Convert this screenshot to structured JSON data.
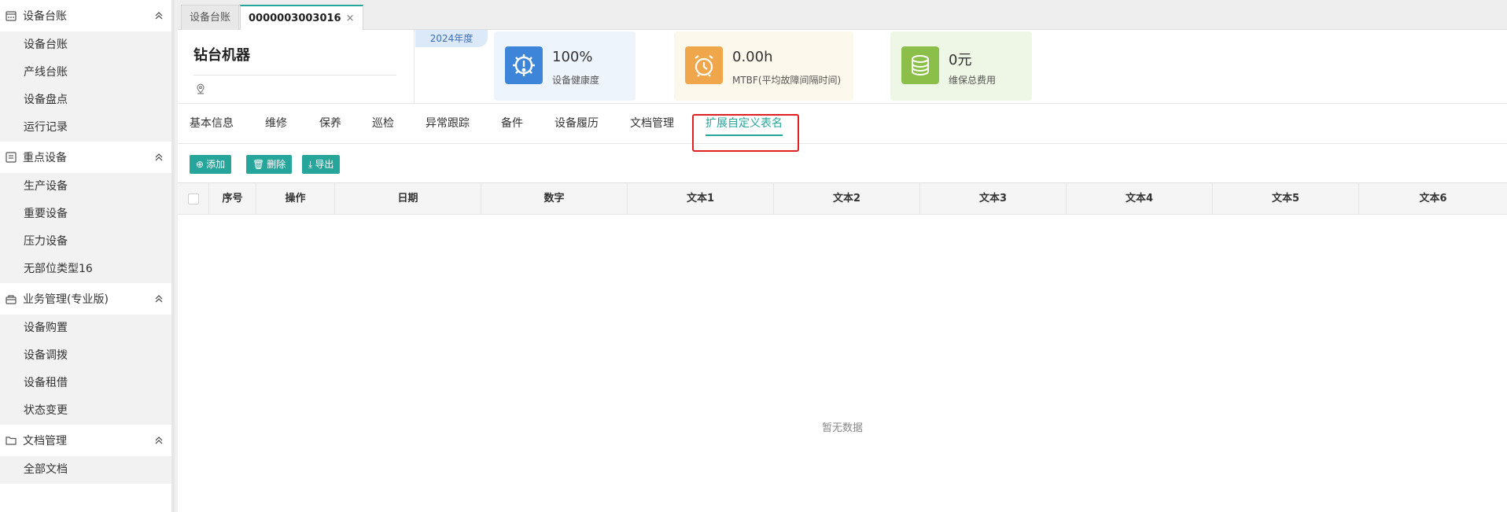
{
  "sidebar": {
    "groups": [
      {
        "label": "设备台账",
        "items": [
          "设备台账",
          "产线台账",
          "设备盘点",
          "运行记录"
        ]
      },
      {
        "label": "重点设备",
        "items": [
          "生产设备",
          "重要设备",
          "压力设备",
          "无部位类型16"
        ]
      },
      {
        "label": "业务管理(专业版)",
        "items": [
          "设备购置",
          "设备调拨",
          "设备租借",
          "状态变更"
        ]
      },
      {
        "label": "文档管理",
        "items": [
          "全部文档"
        ]
      }
    ]
  },
  "tabs": [
    {
      "label": "设备台账"
    },
    {
      "label": "0000003003016",
      "close": "×"
    }
  ],
  "header": {
    "asset_name": "钻台机器",
    "year": "2024年度",
    "stats": [
      {
        "value": "100%",
        "label": "设备健康度",
        "icon": "gear-alert-icon",
        "bg": "#eef4fc",
        "icon_bg": "#3d85d8"
      },
      {
        "value": "0.00h",
        "label": "MTBF(平均故障间隔时间)",
        "icon": "alarm-clock-icon",
        "bg": "#fdf8ec",
        "icon_bg": "#f0a64a"
      },
      {
        "value": "0元",
        "label": "维保总费用",
        "icon": "coin-stack-icon",
        "bg": "#eef7e6",
        "icon_bg": "#8cbf4a"
      }
    ]
  },
  "subtabs": [
    "基本信息",
    "维修",
    "保养",
    "巡检",
    "异常跟踪",
    "备件",
    "设备履历",
    "文档管理",
    "扩展自定义表名"
  ],
  "toolbar": {
    "add": "添加",
    "delete": "删除",
    "export": "导出"
  },
  "table": {
    "columns": [
      "序号",
      "操作",
      "日期",
      "数字",
      "文本1",
      "文本2",
      "文本3",
      "文本4",
      "文本5",
      "文本6"
    ],
    "empty_text": "暂无数据"
  },
  "colors": {
    "accent": "#26a69a",
    "highlight": "#e02020"
  }
}
